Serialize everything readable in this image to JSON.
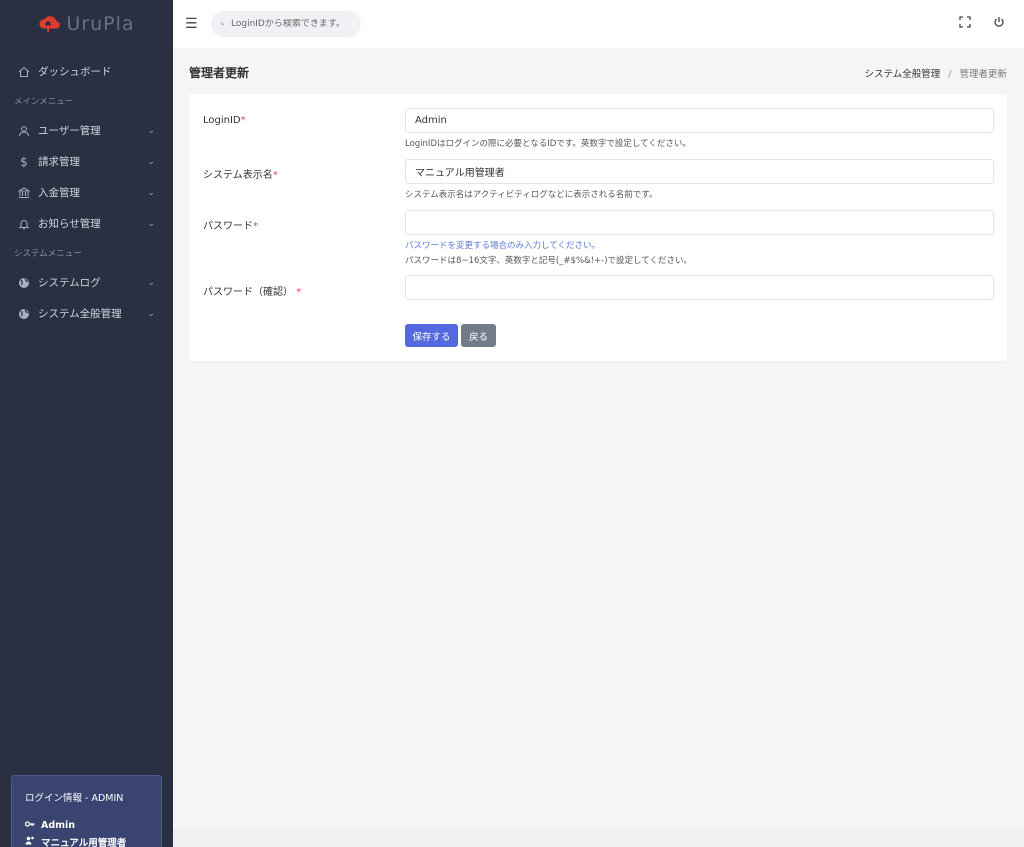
{
  "brand": {
    "name": "UruPla",
    "accent": "#e03b2f"
  },
  "topbar": {
    "search_placeholder": "LoginIDから検索できます。",
    "icons": [
      "menu-icon",
      "search-icon",
      "fullscreen-icon",
      "power-icon"
    ]
  },
  "sidebar": {
    "dashboard": "ダッシュボード",
    "section_main": "メインメニュー",
    "main_items": [
      {
        "label": "ユーザー管理",
        "icon": "user-icon"
      },
      {
        "label": "請求管理",
        "icon": "dollar-icon"
      },
      {
        "label": "入金管理",
        "icon": "bank-icon"
      },
      {
        "label": "お知らせ管理",
        "icon": "bell-icon"
      }
    ],
    "section_system": "システムメニュー",
    "system_items": [
      {
        "label": "システムログ",
        "icon": "globe-icon"
      },
      {
        "label": "システム全般管理",
        "icon": "globe-icon"
      }
    ],
    "login_info": {
      "title": "ログイン情報 - ADMIN",
      "login_id": "Admin",
      "display_name": "マニュアル用管理者"
    }
  },
  "page": {
    "title": "管理者更新",
    "breadcrumb": {
      "parent": "システム全般管理",
      "separator": "/",
      "current": "管理者更新"
    }
  },
  "form": {
    "login_id": {
      "label": "LoginID",
      "required_mark": "*",
      "value": "Admin",
      "help": "LoginIDはログインの際に必要となるIDです。英数字で設定してください。"
    },
    "display_name": {
      "label": "システム表示名",
      "required_mark": "*",
      "value": "マニュアル用管理者",
      "help": "システム表示名はアクティビティログなどに表示される名前です。"
    },
    "password": {
      "label": "パスワード",
      "required_mark": "*",
      "value": "",
      "help_note": "パスワードを変更する場合のみ入力してください。",
      "help": "パスワードは8~16文字、英数字と記号(_#$%&!+-)で設定してください。"
    },
    "password_confirm": {
      "label": "パスワード（確認）",
      "required_mark": "*",
      "value": ""
    },
    "save_label": "保存する",
    "back_label": "戻る"
  }
}
